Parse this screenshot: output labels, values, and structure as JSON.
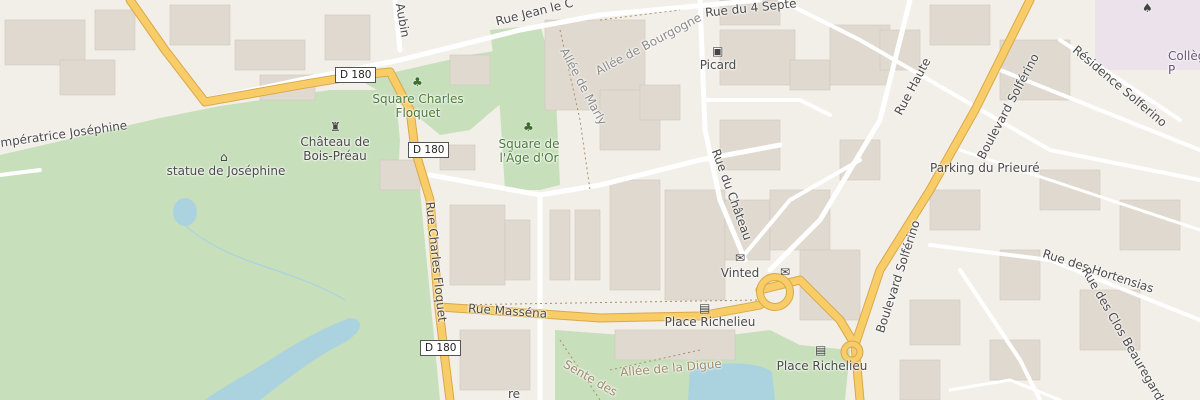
{
  "streets": {
    "rue_jean_le": "Rue Jean le C",
    "rue_aubin": "e Aubin",
    "rue_4_sept": "Rue du 4 Septe",
    "allee_bourgogne": "Allée de Bourgogne",
    "allee_marly": "Allée de Marly",
    "imperatrice": "mpératrice Joséphine",
    "rue_charles_floquet": "Rue Charles Floquet",
    "rue_massena": "Rue Masséna",
    "rue_du_chateau": "Rue du Château",
    "rue_haute": "Rue Haute",
    "bd_solferino": "Boulevard Solférino",
    "residence_solferino": "Résidence Solferino",
    "rue_hortensias": "Rue des Hortensias",
    "rue_clos": "Rue des Clos Beauregards",
    "allee_digue": "Allée de la Digue",
    "sente": "Sente des",
    "rue_bottom": "re"
  },
  "roads": {
    "d180_a": "D 180",
    "d180_b": "D 180",
    "d180_c": "D 180"
  },
  "pois": {
    "square_floquet": "Square Charles\nFloquet",
    "square_age_or": "Square de\nl'Âge d'Or",
    "chateau": "Château de\nBois-Préau",
    "statue": "statue de Joséphine",
    "picard": "Picard",
    "parking": "Parking du Prieuré",
    "vinted": "Vinted",
    "place_richelieu_1": "Place Richelieu",
    "place_richelieu_2": "Place Richelieu",
    "college": "Collèg\nP"
  },
  "colors": {
    "land": "#f2efe9",
    "park": "#c8dfbc",
    "water": "#aad3df",
    "primary_road": "#f8cc66",
    "road_casing": "#d9a84a",
    "building": "#e0d9d0"
  }
}
